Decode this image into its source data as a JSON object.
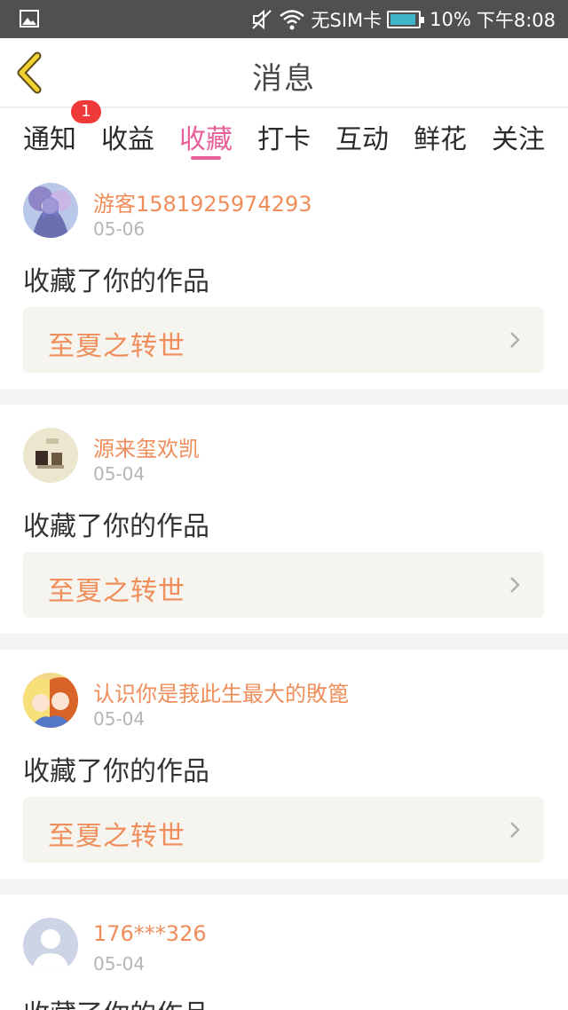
{
  "status_bar": {
    "carrier": "无SIM卡",
    "battery": "10%",
    "time": "下午8:08"
  },
  "header": {
    "title": "消息"
  },
  "tabs": {
    "items": [
      {
        "label": "通知"
      },
      {
        "label": "收益"
      },
      {
        "label": "收藏"
      },
      {
        "label": "打卡"
      },
      {
        "label": "互动"
      },
      {
        "label": "鲜花"
      },
      {
        "label": "关注"
      }
    ],
    "active": "收藏",
    "notification_badge": "1"
  },
  "messages": [
    {
      "user": "游客1581925974293",
      "date": "05-06",
      "action": "收藏了你的作品",
      "work": "至夏之转世"
    },
    {
      "user": "源来玺欢凯",
      "date": "05-04",
      "action": "收藏了你的作品",
      "work": "至夏之转世"
    },
    {
      "user": "认识你是莪此生最大的敗篦",
      "date": "05-04",
      "action": "收藏了你的作品",
      "work": "至夏之转世"
    },
    {
      "user": "176***326",
      "date": "05-04",
      "action": "收藏了你的作品"
    }
  ],
  "colors": {
    "accent": "#e8609a",
    "username": "#ef8e5b",
    "badge": "#f03a3a",
    "status_bar": "#505050"
  }
}
